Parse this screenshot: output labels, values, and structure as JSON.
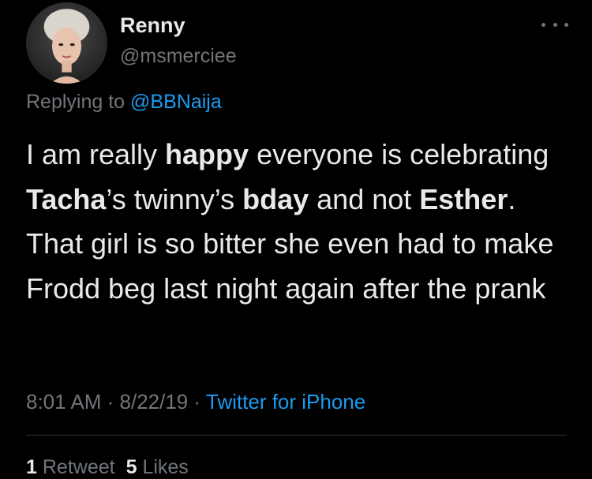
{
  "author": {
    "display_name": "Renny",
    "handle": "@msmerciee",
    "avatar": "profile-photo"
  },
  "more_icon": "more-horizontal-icon",
  "reply": {
    "prefix": "Replying to",
    "mention": "@BBNaija"
  },
  "tweet": {
    "segments": [
      {
        "text": "I am really ",
        "bold": false
      },
      {
        "text": "happy",
        "bold": true
      },
      {
        "text": " everyone is celebrating ",
        "bold": false
      },
      {
        "text": "Tacha",
        "bold": true
      },
      {
        "text": "’s twinny’s ",
        "bold": false
      },
      {
        "text": "bday",
        "bold": true
      },
      {
        "text": " and not ",
        "bold": false
      },
      {
        "text": "Esther",
        "bold": true
      },
      {
        "text": ". That girl is so bitter she even had to make Frodd beg last night again after the prank",
        "bold": false
      }
    ]
  },
  "meta": {
    "time": "8:01 AM",
    "separator": " · ",
    "date": "8/22/19",
    "source": "Twitter for iPhone"
  },
  "stats": {
    "retweets_count": "1",
    "retweets_label": "Retweet",
    "likes_count": "5",
    "likes_label": "Likes"
  },
  "colors": {
    "background": "#000000",
    "text": "#e7e9ea",
    "muted": "#71767b",
    "accent": "#1d9bf0",
    "divider": "#2f3336"
  }
}
